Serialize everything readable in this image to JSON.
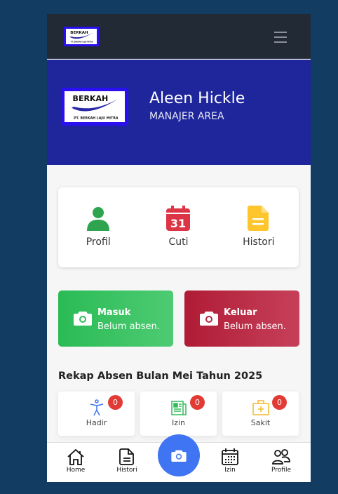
{
  "logo": {
    "title": "BERKAH",
    "subtitle": "PT. BERKAH LAJU MITRA"
  },
  "user": {
    "name": "Aleen Hickle",
    "role": "MANAJER AREA"
  },
  "menu": [
    {
      "label": "Profil",
      "icon": "person-icon"
    },
    {
      "label": "Cuti",
      "icon": "calendar-icon",
      "day": "31"
    },
    {
      "label": "Histori",
      "icon": "document-icon"
    }
  ],
  "attendance": {
    "in": {
      "title": "Masuk",
      "status": "Belum absen."
    },
    "out": {
      "title": "Keluar",
      "status": "Belum absen."
    }
  },
  "recap": {
    "title": "Rekap Absen Bulan Mei Tahun 2025",
    "items": [
      {
        "label": "Hadir",
        "count": "0"
      },
      {
        "label": "Izin",
        "count": "0"
      },
      {
        "label": "Sakit",
        "count": "0"
      }
    ]
  },
  "bottom_nav": [
    {
      "label": "Home"
    },
    {
      "label": "Histori"
    },
    {
      "label": "Izin"
    },
    {
      "label": "Profile"
    }
  ],
  "colors": {
    "hero": "#1f269b",
    "navbar": "#222a35",
    "fab": "#3f74f2",
    "masuk": "#2abb55",
    "keluar": "#b01b35"
  }
}
